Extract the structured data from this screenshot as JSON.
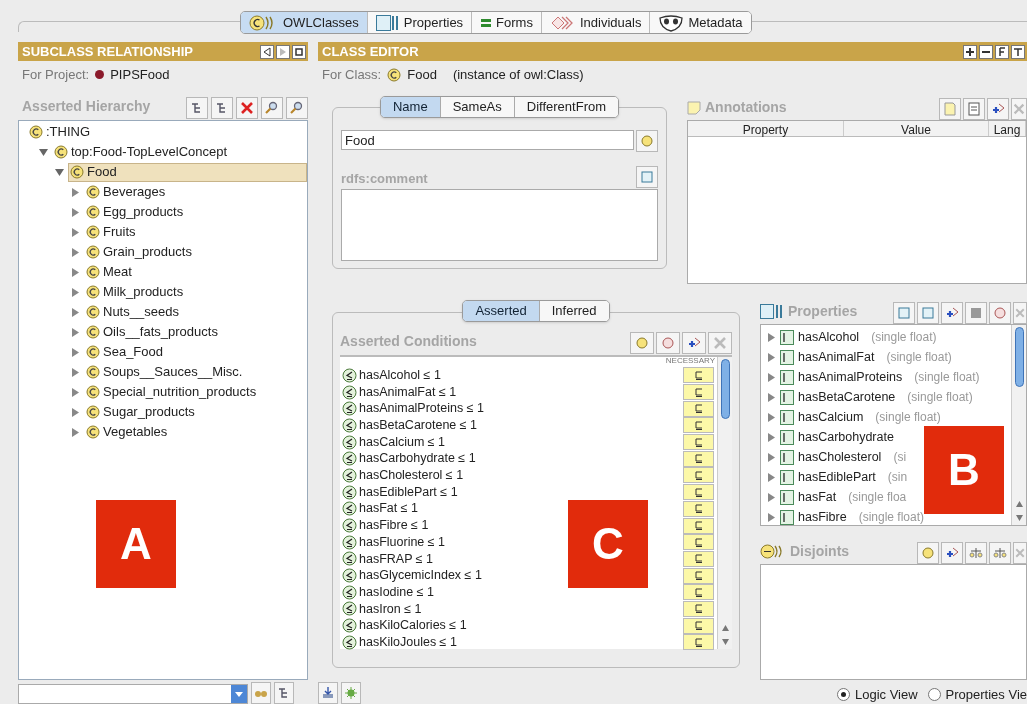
{
  "top_tabs": [
    {
      "label": "OWLClasses",
      "kind": "classes",
      "selected": true
    },
    {
      "label": "Properties",
      "kind": "properties",
      "selected": false
    },
    {
      "label": "Forms",
      "kind": "forms",
      "selected": false
    },
    {
      "label": "Individuals",
      "kind": "individuals",
      "selected": false
    },
    {
      "label": "Metadata",
      "kind": "metadata",
      "selected": false
    }
  ],
  "left_panel": {
    "title": "SUBCLASS RELATIONSHIP",
    "project_label": "For Project:",
    "project": "PIPSFood",
    "hierarchy_title": "Asserted Hierarchy",
    "tree": {
      "label": ":THING",
      "children": [
        {
          "label": "top:Food-TopLevelConcept",
          "expanded": true,
          "selected": false,
          "children": [
            {
              "label": "Food",
              "expanded": true,
              "selected": true,
              "children": [
                {
                  "label": "Beverages",
                  "expanded": false,
                  "selected": false
                },
                {
                  "label": "Egg_products",
                  "expanded": false,
                  "selected": false
                },
                {
                  "label": "Fruits",
                  "expanded": false,
                  "selected": false
                },
                {
                  "label": "Grain_products",
                  "expanded": false,
                  "selected": false
                },
                {
                  "label": "Meat",
                  "expanded": false,
                  "selected": false
                },
                {
                  "label": "Milk_products",
                  "expanded": false,
                  "selected": false
                },
                {
                  "label": "Nuts__seeds",
                  "expanded": false,
                  "selected": false
                },
                {
                  "label": "Oils__fats_products",
                  "expanded": false,
                  "selected": false
                },
                {
                  "label": "Sea_Food",
                  "expanded": false,
                  "selected": false
                },
                {
                  "label": "Soups__Sauces__Misc.",
                  "expanded": false,
                  "selected": false
                },
                {
                  "label": "Special_nutrition_products",
                  "expanded": false,
                  "selected": false
                },
                {
                  "label": "Sugar_products",
                  "expanded": false,
                  "selected": false
                },
                {
                  "label": "Vegetables",
                  "expanded": false,
                  "selected": false
                }
              ]
            }
          ]
        }
      ]
    }
  },
  "class_editor": {
    "title": "CLASS EDITOR",
    "class_label": "For Class:",
    "class_name": "Food",
    "class_type": "(instance of owl:Class)",
    "name_tabs": [
      {
        "label": "Name",
        "selected": true
      },
      {
        "label": "SameAs",
        "selected": false
      },
      {
        "label": "DifferentFrom",
        "selected": false
      }
    ],
    "name_value": "Food",
    "comment_label": "rdfs:comment",
    "annotations": {
      "title": "Annotations",
      "columns": [
        "Property",
        "Value",
        "Lang"
      ]
    },
    "condition_tabs": [
      {
        "label": "Asserted",
        "selected": true
      },
      {
        "label": "Inferred",
        "selected": false
      }
    ],
    "conditions": {
      "title": "Asserted Conditions",
      "column_label": "NECESSARY",
      "items": [
        {
          "text": "hasAlcohol ≤ 1",
          "kind": "necessary"
        },
        {
          "text": "hasAnimalFat ≤ 1",
          "kind": "necessary"
        },
        {
          "text": "hasAnimalProteins ≤ 1",
          "kind": "necessary"
        },
        {
          "text": "hasBetaCarotene ≤ 1",
          "kind": "necessary"
        },
        {
          "text": "hasCalcium ≤ 1",
          "kind": "necessary"
        },
        {
          "text": "hasCarbohydrate ≤ 1",
          "kind": "necessary"
        },
        {
          "text": "hasCholesterol ≤ 1",
          "kind": "necessary"
        },
        {
          "text": "hasEdiblePart ≤ 1",
          "kind": "necessary"
        },
        {
          "text": "hasFat ≤ 1",
          "kind": "necessary"
        },
        {
          "text": "hasFibre ≤ 1",
          "kind": "necessary"
        },
        {
          "text": "hasFluorine ≤ 1",
          "kind": "necessary"
        },
        {
          "text": "hasFRAP ≤ 1",
          "kind": "necessary"
        },
        {
          "text": "hasGlycemicIndex ≤ 1",
          "kind": "necessary"
        },
        {
          "text": "hasIodine ≤ 1",
          "kind": "necessary"
        },
        {
          "text": "hasIron ≤ 1",
          "kind": "necessary"
        },
        {
          "text": "hasKiloCalories ≤ 1",
          "kind": "necessary"
        },
        {
          "text": "hasKiloJoules ≤ 1",
          "kind": "necessary"
        }
      ]
    },
    "properties": {
      "title": "Properties",
      "items": [
        {
          "name": "hasAlcohol",
          "type": "(single float)"
        },
        {
          "name": "hasAnimalFat",
          "type": "(single float)"
        },
        {
          "name": "hasAnimalProteins",
          "type": "(single float)"
        },
        {
          "name": "hasBetaCarotene",
          "type": "(single float)"
        },
        {
          "name": "hasCalcium",
          "type": "(single float)"
        },
        {
          "name": "hasCarbohydrate"
        },
        {
          "name": "hasCholesterol",
          "type": "(si"
        },
        {
          "name": "hasEdiblePart",
          "type": "(sin"
        },
        {
          "name": "hasFat",
          "type": "(single floa"
        },
        {
          "name": "hasFibre",
          "type": "(single float)"
        }
      ]
    },
    "disjoints": {
      "title": "Disjoints"
    },
    "view_options": [
      {
        "label": "Logic View",
        "selected": true
      },
      {
        "label": "Properties Vie",
        "selected": false
      }
    ]
  },
  "callouts": [
    {
      "label": "A"
    },
    {
      "label": "B"
    },
    {
      "label": "C"
    }
  ]
}
